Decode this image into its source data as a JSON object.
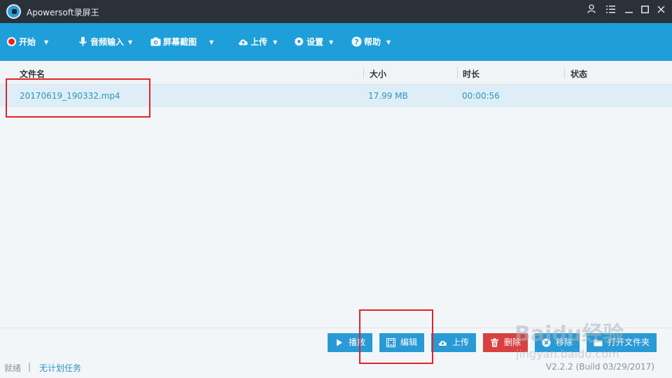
{
  "window": {
    "title": "Apowersoft录屏王"
  },
  "toolbar": {
    "items": [
      {
        "label": "开始"
      },
      {
        "label": "音频输入"
      },
      {
        "label": "屏幕截图"
      },
      {
        "label": "上传"
      },
      {
        "label": "设置"
      },
      {
        "label": "帮助"
      }
    ]
  },
  "list": {
    "columns": [
      "文件名",
      "大小",
      "时长",
      "状态"
    ],
    "rows": [
      {
        "filename": "20170619_190332.mp4",
        "size": "17.99 MB",
        "duration": "00:00:56",
        "status": ""
      }
    ]
  },
  "actions": [
    {
      "label": "播放"
    },
    {
      "label": "编辑"
    },
    {
      "label": "上传"
    },
    {
      "label": "删除"
    },
    {
      "label": "移除"
    },
    {
      "label": "打开文件夹"
    }
  ],
  "statusbar": {
    "state": "就绪",
    "separator": "|",
    "task": "无计划任务",
    "version": "V2.2.2 (Build 03/29/2017)"
  },
  "watermark": {
    "brand": "Baidu经验",
    "url": "jingyan.baidu.com"
  },
  "colors": {
    "titlebar": "#2a3139",
    "toolbar": "#1e9fd9",
    "selected_row": "#ddeef7",
    "accent_text": "#2f93c9",
    "delete_button": "#d94141",
    "highlight": "#e2242a"
  }
}
